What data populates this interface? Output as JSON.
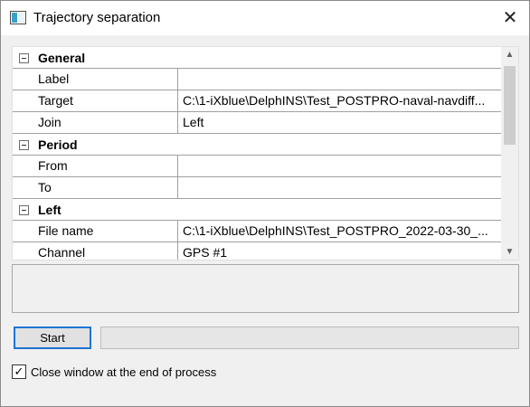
{
  "window": {
    "title": "Trajectory separation",
    "close_glyph": "✕",
    "icon": "app-window-icon"
  },
  "grid": {
    "rows": [
      {
        "type": "category",
        "label": "General",
        "expanded": true
      },
      {
        "type": "property",
        "name": "Label",
        "value": ""
      },
      {
        "type": "property",
        "name": "Target",
        "value": "C:\\1-iXblue\\DelphINS\\Test_POSTPRO-naval-navdiff..."
      },
      {
        "type": "property",
        "name": "Join",
        "value": "Left"
      },
      {
        "type": "category",
        "label": "Period",
        "expanded": true
      },
      {
        "type": "property",
        "name": "From",
        "value": ""
      },
      {
        "type": "property",
        "name": "To",
        "value": ""
      },
      {
        "type": "category",
        "label": "Left",
        "expanded": true
      },
      {
        "type": "property",
        "name": "File name",
        "value": "C:\\1-iXblue\\DelphINS\\Test_POSTPRO_2022-03-30_..."
      },
      {
        "type": "property",
        "name": "Channel",
        "value": "GPS #1"
      }
    ],
    "scroll_up_glyph": "▲",
    "scroll_down_glyph": "▼"
  },
  "description": "",
  "actions": {
    "start_label": "Start",
    "progress_percent": 0
  },
  "options": {
    "close_at_end_label": "Close window at the end of process",
    "close_at_end_checked": true,
    "check_glyph": "✓"
  }
}
